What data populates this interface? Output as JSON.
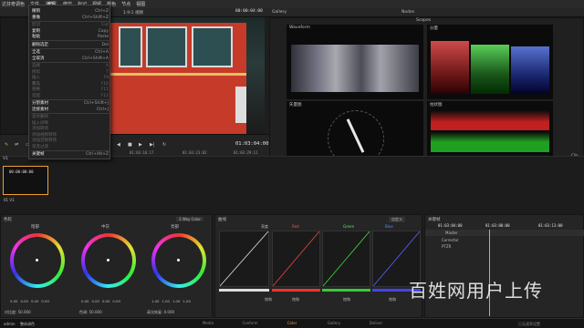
{
  "menubar": {
    "items": [
      "达芬奇调色",
      "文件",
      "编辑",
      "修剪",
      "标记",
      "视频",
      "颜色",
      "节点",
      "视图"
    ],
    "active_index": 2
  },
  "viewer": {
    "title": "1.9:1 视频",
    "timecode_top": "00:00:04:00",
    "timecode_main": "01:03:04:00",
    "tc_left": "01:03:16:17",
    "tc_mid": "01:03:23:02",
    "tc_right": "01:03:29:11"
  },
  "edit_menu": [
    {
      "label": "撤销",
      "shortcut": "Ctrl+Z",
      "enabled": true
    },
    {
      "label": "重做",
      "shortcut": "Ctrl+Shift+Z",
      "enabled": true
    },
    {
      "label": "剪切",
      "shortcut": "Cut",
      "enabled": false
    },
    {
      "label": "复制",
      "shortcut": "Copy",
      "enabled": true
    },
    {
      "label": "粘贴",
      "shortcut": "Paste",
      "enabled": true
    },
    {
      "label": "删除选定",
      "shortcut": "Del",
      "enabled": true
    },
    {
      "label": "全选",
      "shortcut": "Ctrl+A",
      "enabled": true
    },
    {
      "label": "全取消",
      "shortcut": "Ctrl+Shift+A",
      "enabled": true
    },
    {
      "label": "选择",
      "shortcut": "A",
      "enabled": false
    },
    {
      "label": "修剪",
      "shortcut": "T",
      "enabled": false
    },
    {
      "label": "插入",
      "shortcut": "F9",
      "enabled": false
    },
    {
      "label": "覆盖",
      "shortcut": "F10",
      "enabled": false
    },
    {
      "label": "替换",
      "shortcut": "F11",
      "enabled": false
    },
    {
      "label": "适配",
      "shortcut": "F12",
      "enabled": false
    },
    {
      "label": "分割素材",
      "shortcut": "Ctrl+Shift+J",
      "enabled": true
    },
    {
      "label": "连接素材",
      "shortcut": "Ctrl+J",
      "enabled": true
    },
    {
      "label": "波纹删除",
      "shortcut": "",
      "enabled": false
    },
    {
      "label": "插入间隙",
      "shortcut": "",
      "enabled": false
    },
    {
      "label": "添加转场",
      "shortcut": "",
      "enabled": false
    },
    {
      "label": "添加视频转场",
      "shortcut": "",
      "enabled": false
    },
    {
      "label": "添加音频转场",
      "shortcut": "",
      "enabled": false
    },
    {
      "label": "渐变过渡",
      "shortcut": "",
      "enabled": false
    },
    {
      "label": "关键帧",
      "shortcut": "Ctrl+Alt+Z",
      "enabled": true
    }
  ],
  "scopes": {
    "gallery_tab": "Gallery",
    "nodes_tab": "Nodes",
    "scopes_title": "Scopes",
    "waveform_label": "Waveform",
    "parade_label": "分量",
    "vectorscope_label": "矢量图",
    "histogram_label": "柱状图",
    "clip_label": "Clip",
    "scale_top": "1023",
    "scale_marks": [
      "896",
      "768",
      "640",
      "512",
      "384",
      "256",
      "128",
      "0"
    ]
  },
  "timeline": {
    "track_label": "V1",
    "clip_tc": "00:00:00:00",
    "clip_name": "01 V1"
  },
  "color_wheels": {
    "title": "色轮",
    "mode": "3 Way Color",
    "wheels": [
      {
        "name": "暗部",
        "values": [
          "0.00",
          "0.00",
          "0.00",
          "0.00"
        ]
      },
      {
        "name": "中灰",
        "values": [
          "0.00",
          "0.00",
          "0.00",
          "0.00"
        ]
      },
      {
        "name": "亮部",
        "values": [
          "1.00",
          "1.00",
          "1.00",
          "1.00"
        ]
      }
    ],
    "footer_left": "对比度: 50.000",
    "footer_mid": "色调: 50.000",
    "footer_right": "高光恢复: 0.000"
  },
  "curves": {
    "title": "曲线",
    "channels": [
      "亮度",
      "Red",
      "Green",
      "Blue"
    ],
    "dropdown": "自定义",
    "footer_labels": [
      "饱和",
      "饱和",
      "饱和",
      "饱和"
    ]
  },
  "keyframes": {
    "title": "关键帧",
    "tc_left": "01:03:04:00",
    "tc_mid": "01:03:00:00",
    "tc_right": "01:03:13:00",
    "rows": [
      "Master",
      "Corrector",
      "PTZR"
    ]
  },
  "bottom": {
    "username": "admin",
    "project": "整体调色",
    "tabs": [
      "Media",
      "Conform",
      "Color",
      "Gallery",
      "Deliver"
    ],
    "active_tab": 2,
    "status_right": "已无速率设置"
  },
  "watermark": "百姓网用户上传",
  "colors": {
    "accent": "#f0a030",
    "bus_red": "#c63a2a",
    "panel": "#252525"
  }
}
